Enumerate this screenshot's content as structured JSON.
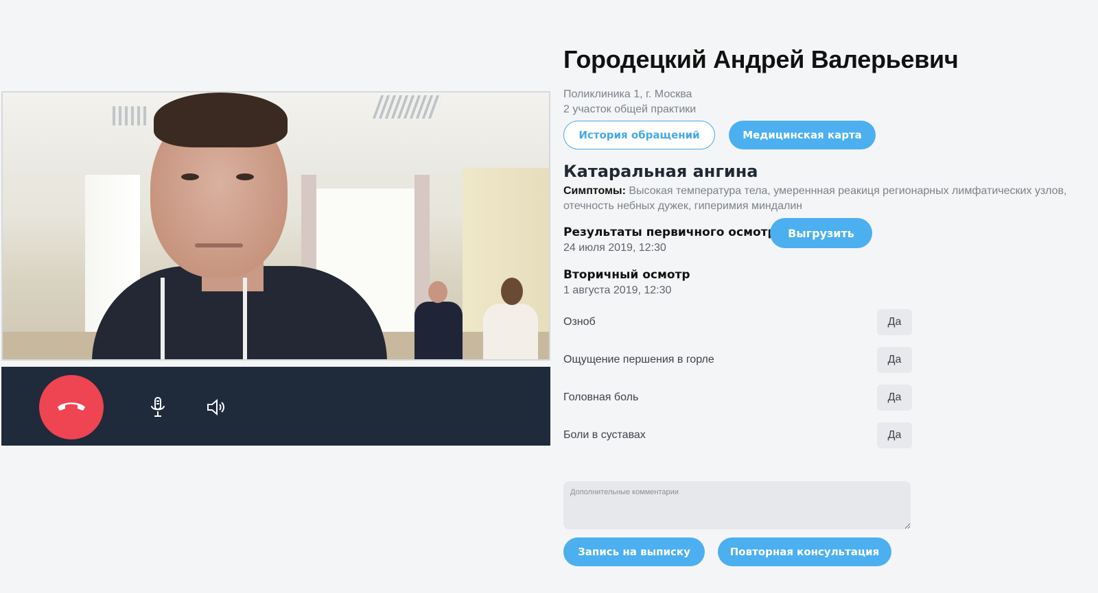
{
  "patient": {
    "name": "Городецкий Андрей Валерьевич",
    "clinic": "Поликлиника 1, г. Москва",
    "district": "2 участок общей практики"
  },
  "actions": {
    "history_label": "История обращений",
    "medcard_label": "Медицинская карта"
  },
  "diagnosis": {
    "title": "Катаральная ангина",
    "symptoms_label": "Симптомы:",
    "symptoms_text": "Высокая температура тела, умереннная реакиця регионарных лимфатических узлов, отечность небных дужек, гиперимия миндалин"
  },
  "primary_exam": {
    "title": "Результаты первичного осмотра",
    "date": "24 июля 2019, 12:30",
    "export_label": "Выгрузить"
  },
  "secondary_exam": {
    "title": "Вторичный осмотр",
    "date": "1 августа 2019, 12:30",
    "questions": [
      {
        "label": "Озноб",
        "answer": "Да"
      },
      {
        "label": "Ощущение першения в горле",
        "answer": "Да"
      },
      {
        "label": "Головная боль",
        "answer": "Да"
      },
      {
        "label": "Боли в суставах",
        "answer": "Да"
      }
    ]
  },
  "comments": {
    "placeholder": "Дополнительные комментарии",
    "value": ""
  },
  "footer": {
    "discharge_label": "Запись на выписку",
    "repeat_label": "Повторная консультация"
  },
  "call_controls": {
    "hangup_icon": "phone-hangup-icon",
    "mic_icon": "microphone-icon",
    "speaker_icon": "speaker-volume-icon"
  },
  "colors": {
    "accent": "#4caff0",
    "hangup": "#ef4452",
    "control_bar": "#1f2a3b",
    "background": "#f4f5f6"
  }
}
